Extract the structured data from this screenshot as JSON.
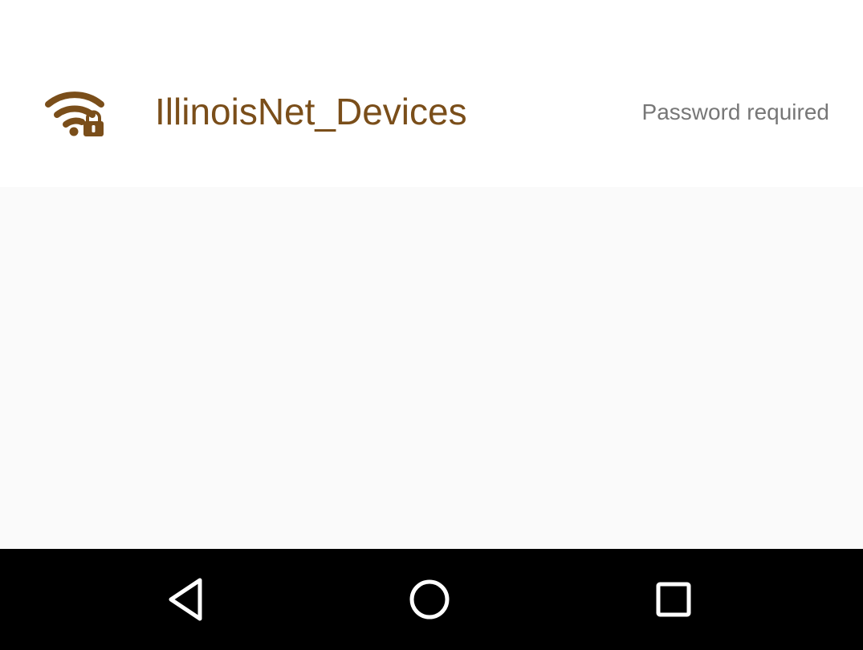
{
  "network": {
    "ssid": "IllinoisNet_Devices",
    "status": "Password required",
    "icon": "wifi-lock-icon"
  },
  "navigation": {
    "back_icon": "back-triangle-icon",
    "home_icon": "home-circle-icon",
    "recents_icon": "recents-square-icon"
  },
  "colors": {
    "accent": "#7a4e1a",
    "status_text": "#777777",
    "nav_background": "#000000",
    "content_background": "#fafafa"
  }
}
